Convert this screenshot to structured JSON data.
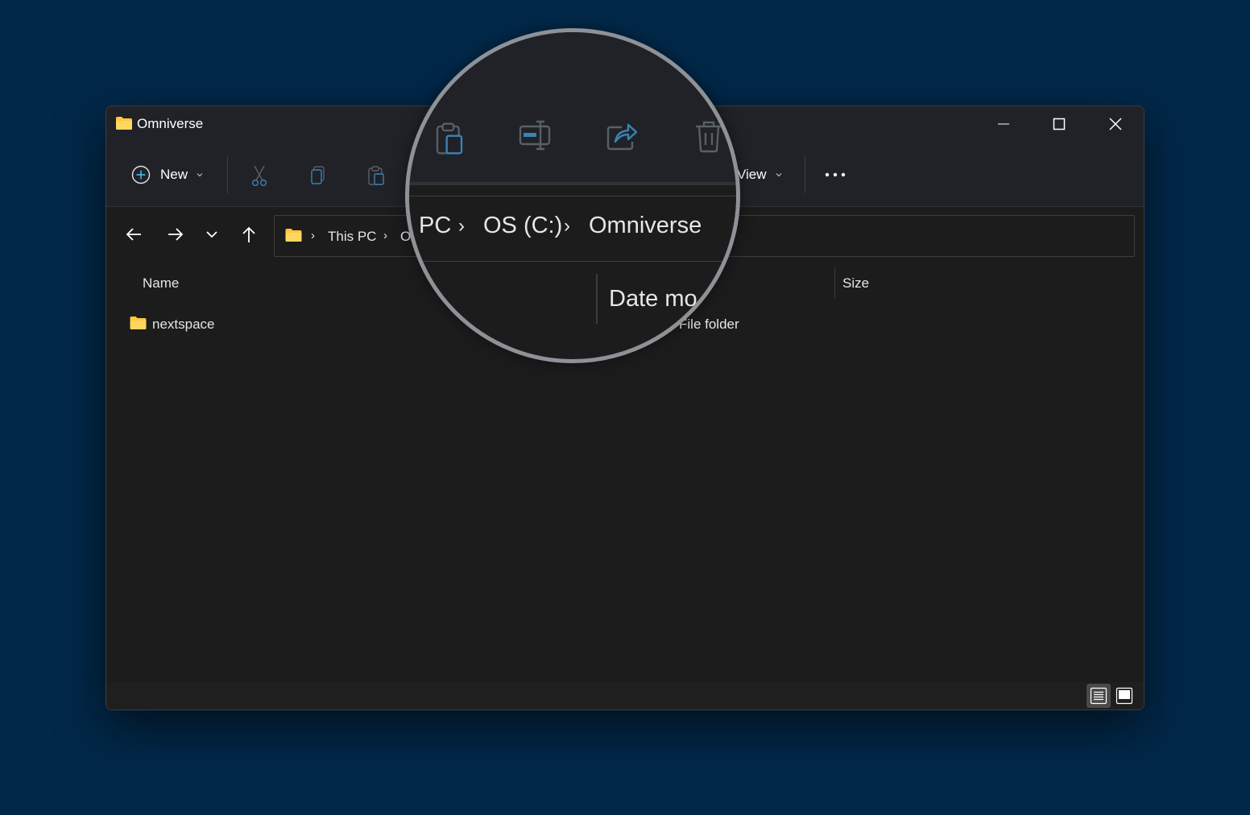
{
  "window": {
    "title": "Omniverse"
  },
  "toolbar": {
    "new_label": "New",
    "view_label": "View",
    "tools": [
      "cut-icon",
      "copy-icon",
      "paste-icon",
      "rename-icon",
      "share-icon",
      "delete-icon"
    ],
    "more_icon": "more-icon"
  },
  "navigation": {
    "back_icon": "back-arrow-icon",
    "forward_icon": "forward-arrow-icon",
    "recent_icon": "chevron-down-icon",
    "up_icon": "up-arrow-icon"
  },
  "address": {
    "crumbs": [
      "This PC",
      "OS (C:)",
      "Omniverse"
    ],
    "visible_partial": "O",
    "magnified_crumbs": [
      "PC",
      "OS (C:)",
      "Omniverse"
    ]
  },
  "columns": {
    "name": "Name",
    "date": "Date modified",
    "date_visible": "Date mo",
    "type_fragment": "e",
    "size": "Size"
  },
  "files": [
    {
      "name": "nextspace",
      "type": "File folder",
      "icon": "folder-icon"
    }
  ],
  "colors": {
    "desktop": "#022849",
    "window": "#1c1c1c",
    "toolbar": "#202227",
    "folder": "#ffc83d",
    "accent_disabled": "#3c82b4"
  }
}
